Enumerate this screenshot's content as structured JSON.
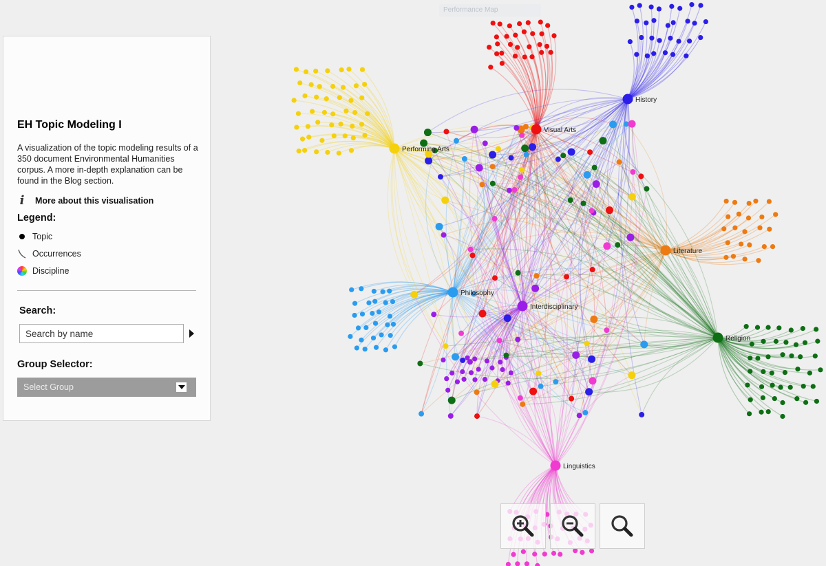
{
  "app": {
    "top_badge": "Performance Map"
  },
  "panel": {
    "title": "EH Topic Modeling I",
    "description": "A visualization of the topic modeling results of a 350 document Environmental Humanities corpus. A more in-depth explanation can be found in the Blog section.",
    "more_link": "More about this visualisation",
    "legend": {
      "title": "Legend:",
      "items": [
        {
          "icon": "topic-dot-icon",
          "label": "Topic"
        },
        {
          "icon": "occurrence-curve-icon",
          "label": "Occurrences"
        },
        {
          "icon": "color-wheel-icon",
          "label": "Discipline"
        }
      ]
    },
    "search": {
      "title": "Search:",
      "placeholder": "Search by name",
      "value": ""
    },
    "group_selector": {
      "title": "Group Selector:",
      "selected": "Select Group"
    }
  },
  "zoom_controls": [
    {
      "name": "zoom-in-button",
      "icon": "zoom-in-icon"
    },
    {
      "name": "zoom-out-button",
      "icon": "zoom-out-icon"
    },
    {
      "name": "zoom-reset-button",
      "icon": "magnifier-icon"
    }
  ],
  "network": {
    "disciplines": [
      {
        "id": "history",
        "label": "History",
        "color": "#2b1ee8",
        "leaf_count": 30
      },
      {
        "id": "visual_arts",
        "label": "Visual Arts",
        "color": "#ee1111",
        "leaf_count": 30
      },
      {
        "id": "performing_arts",
        "label": "Performing Arts",
        "color": "#f5d10d",
        "leaf_count": 48
      },
      {
        "id": "literature",
        "label": "Literature",
        "color": "#ee7a12",
        "leaf_count": 24
      },
      {
        "id": "philosophy",
        "label": "Philosophy",
        "color": "#2a9cf0",
        "leaf_count": 30
      },
      {
        "id": "interdisciplinary",
        "label": "Interdisciplinary",
        "color": "#9a1ee8",
        "leaf_count": 22
      },
      {
        "id": "religion",
        "label": "Religion",
        "color": "#0e6e14",
        "leaf_count": 46
      },
      {
        "id": "linguistics",
        "label": "Linguistics",
        "color": "#f03ad0",
        "leaf_count": 40
      }
    ],
    "shared_topic_counts": {
      "history": 12,
      "visual_arts": 12,
      "performing_arts": 12,
      "literature": 9,
      "philosophy": 14,
      "interdisciplinary": 16,
      "religion": 16,
      "linguistics": 14
    }
  }
}
